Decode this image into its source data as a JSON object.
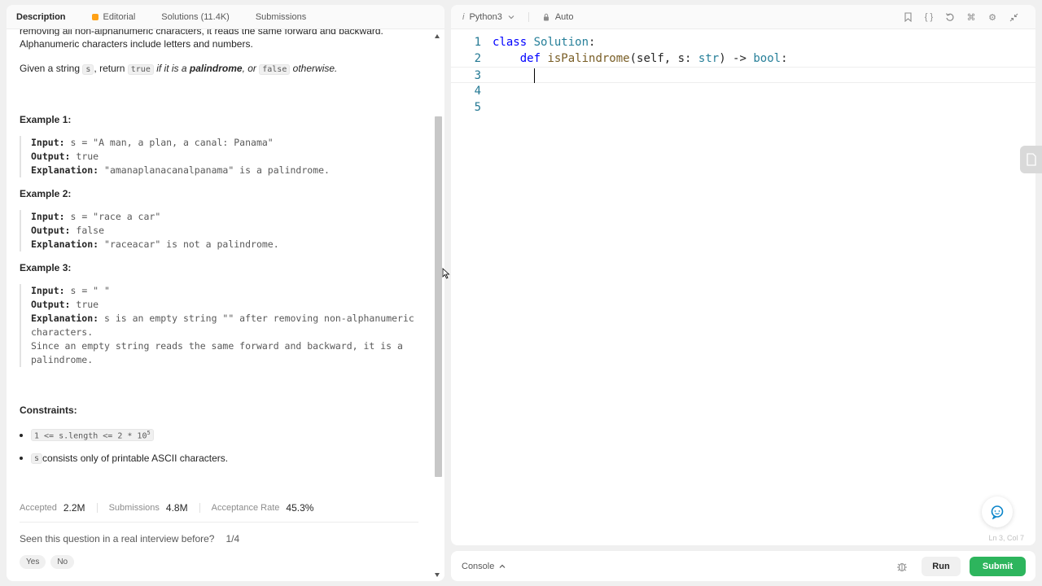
{
  "left_tabs": [
    {
      "label": "Description"
    },
    {
      "label": "Editorial"
    },
    {
      "label": "Solutions (11.4K)"
    },
    {
      "label": "Submissions"
    }
  ],
  "description": {
    "cut_line": "removing all non-alphanumeric characters, it reads the same forward and backward.",
    "line2": "Alphanumeric characters include letters and numbers.",
    "given_prefix": "Given a string ",
    "given_s": "s",
    "given_return": ", return ",
    "given_true": "true",
    "given_if": " if it is a ",
    "given_palindrome": "palindrome",
    "given_or": ", or ",
    "given_false": "false",
    "given_otherwise": " otherwise."
  },
  "examples": [
    {
      "title": "Example 1:",
      "input_label": "Input:",
      "input": " s = \"A man, a plan, a canal: Panama\"",
      "output_label": "Output:",
      "output": " true",
      "explanation_label": "Explanation:",
      "explanation": " \"amanaplanacanalpanama\" is a palindrome."
    },
    {
      "title": "Example 2:",
      "input_label": "Input:",
      "input": " s = \"race a car\"",
      "output_label": "Output:",
      "output": " false",
      "explanation_label": "Explanation:",
      "explanation": " \"raceacar\" is not a palindrome."
    },
    {
      "title": "Example 3:",
      "input_label": "Input:",
      "input": " s = \" \"",
      "output_label": "Output:",
      "output": " true",
      "explanation_label": "Explanation:",
      "explanation": " s is an empty string \"\" after removing non-alphanumeric characters.",
      "explanation2": "Since an empty string reads the same forward and backward, it is a palindrome."
    }
  ],
  "constraints": {
    "title": "Constraints:",
    "c1_code": "1 <= s.length <= 2 * 10",
    "c1_sup": "5",
    "c2_code": "s",
    "c2_text": " consists only of printable ASCII characters."
  },
  "stats": {
    "accepted_label": "Accepted",
    "accepted": "2.2M",
    "submissions_label": "Submissions",
    "submissions": "4.8M",
    "rate_label": "Acceptance Rate",
    "rate": "45.3%"
  },
  "interview": {
    "question": "Seen this question in a real interview before?",
    "page": "1/4",
    "yes": "Yes",
    "no": "No"
  },
  "editor_top": {
    "language": "Python3",
    "mode": "Auto"
  },
  "code_lines": [
    {
      "num": "1",
      "parts": [
        [
          "kw",
          "class"
        ],
        [
          "",
          "  "
        ],
        [
          "cls",
          "Solution"
        ],
        [
          "",
          ":"
        ]
      ]
    },
    {
      "num": "2",
      "parts": [
        [
          "",
          "    "
        ],
        [
          "kw",
          "def"
        ],
        [
          "",
          " "
        ],
        [
          "fn",
          "isPalindrome"
        ],
        [
          "",
          "(self, s: "
        ],
        [
          "cls",
          "str"
        ],
        [
          "",
          ") -> "
        ],
        [
          "cls",
          "bool"
        ],
        [
          "",
          ":"
        ]
      ]
    },
    {
      "num": "3",
      "parts": []
    },
    {
      "num": "4",
      "parts": []
    },
    {
      "num": "5",
      "parts": []
    }
  ],
  "status": "Ln 3, Col 7",
  "bottom": {
    "console": "Console",
    "run": "Run",
    "submit": "Submit"
  },
  "colors": {
    "accent_green": "#2db55d",
    "lock_orange": "#ffa116"
  }
}
